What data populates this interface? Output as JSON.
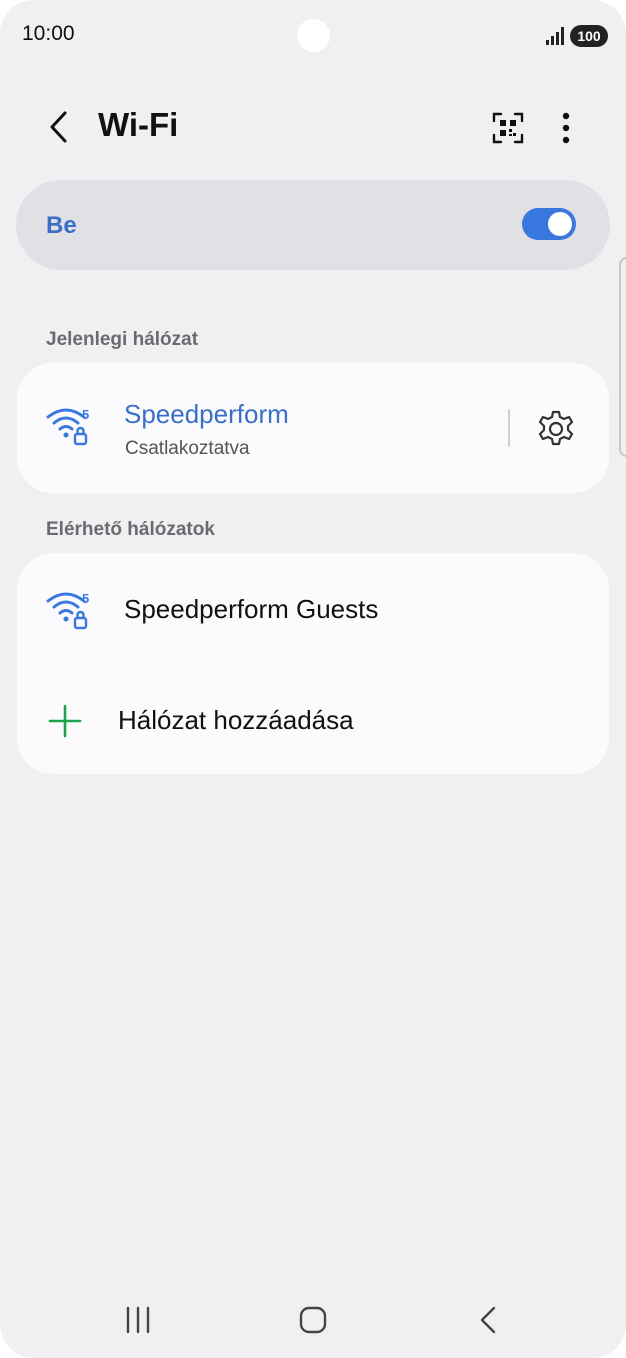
{
  "status_bar": {
    "time": "10:00",
    "battery": "100"
  },
  "header": {
    "title": "Wi-Fi"
  },
  "master_switch": {
    "label": "Be",
    "state": "on"
  },
  "current_section": {
    "title": "Jelenlegi hálózat"
  },
  "current_network": {
    "name": "Speedperform",
    "status": "Csatlakoztatva"
  },
  "available_section": {
    "title": "Elérhető hálózatok"
  },
  "available_networks": [
    {
      "name": "Speedperform Guests"
    }
  ],
  "add_network": {
    "label": "Hálózat hozzáadása"
  },
  "wifi_badge": "5",
  "colors": {
    "accent": "#3a78e0",
    "link": "#3a6fc9",
    "add_icon": "#1fa34a",
    "background": "#f0f0f2"
  }
}
